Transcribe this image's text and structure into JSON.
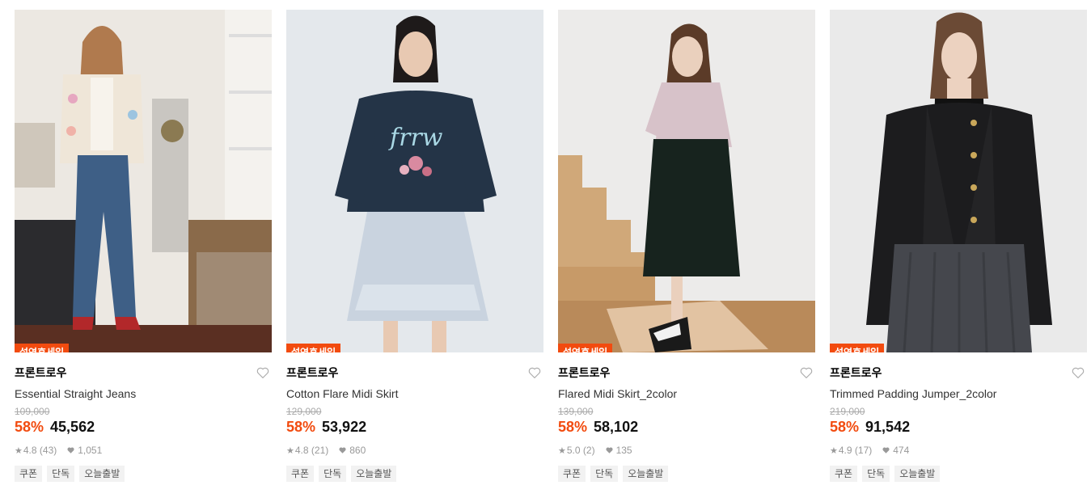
{
  "products": [
    {
      "badge": "설연휴세일",
      "brand": "프론트로우",
      "name": "Essential Straight Jeans",
      "original_price": "109,000",
      "discount": "58%",
      "price": "45,562",
      "rating": "4.8",
      "reviews": "(43)",
      "likes": "1,051",
      "tags": [
        "쿠폰",
        "단독",
        "오늘출발"
      ]
    },
    {
      "badge": "설연휴세일",
      "brand": "프론트로우",
      "name": "Cotton Flare Midi Skirt",
      "original_price": "129,000",
      "discount": "58%",
      "price": "53,922",
      "rating": "4.8",
      "reviews": "(21)",
      "likes": "860",
      "tags": [
        "쿠폰",
        "단독",
        "오늘출발"
      ]
    },
    {
      "badge": "설연휴세일",
      "brand": "프론트로우",
      "name": "Flared Midi Skirt_2color",
      "original_price": "139,000",
      "discount": "58%",
      "price": "58,102",
      "rating": "5.0",
      "reviews": "(2)",
      "likes": "135",
      "tags": [
        "쿠폰",
        "단독",
        "오늘출발"
      ]
    },
    {
      "badge": "설연휴세일",
      "brand": "프론트로우",
      "name": "Trimmed Padding Jumper_2color",
      "original_price": "219,000",
      "discount": "58%",
      "price": "91,542",
      "rating": "4.9",
      "reviews": "(17)",
      "likes": "474",
      "tags": [
        "쿠폰",
        "단독",
        "오늘출발"
      ]
    }
  ],
  "colors": {
    "accent": "#f24b0f",
    "muted": "#999999",
    "tag_bg": "#f2f2f2"
  },
  "icons": [
    "wishlist-heart-icon",
    "star-icon",
    "like-heart-icon"
  ]
}
